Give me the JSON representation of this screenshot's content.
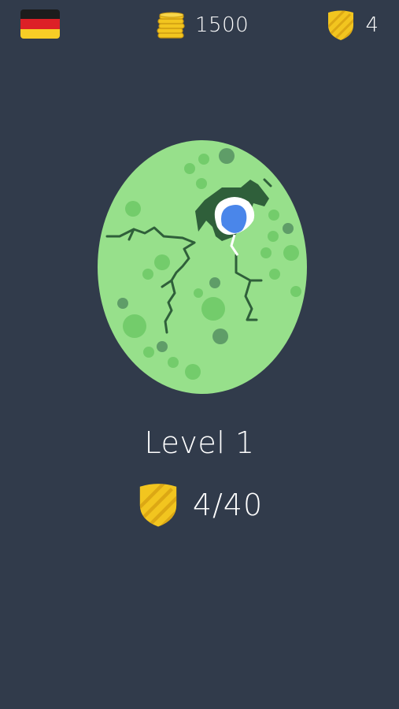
{
  "header": {
    "flag_icon": "germany-flag-icon",
    "coins": {
      "icon": "coin-stack-icon",
      "value": "1500"
    },
    "shields": {
      "icon": "shield-icon",
      "value": "4"
    }
  },
  "egg": {
    "icon": "cracked-egg-icon"
  },
  "level": {
    "title": "Level 1",
    "progress_icon": "shield-icon",
    "progress_text": "4/40",
    "progress_fraction": 0.1
  },
  "colors": {
    "background": "#313b4b",
    "egg_base": "#97e08b",
    "egg_spot": "#73cc6b",
    "egg_spot_dark": "#5f9d68",
    "crack": "#2f5f3a",
    "creature_eye": "#4a86ea",
    "shield_gold": "#f2c51f",
    "coin_gold": "#f2c51f",
    "flag_black": "#1c1c1c",
    "flag_red": "#dd2027",
    "flag_gold": "#f7cd26"
  }
}
